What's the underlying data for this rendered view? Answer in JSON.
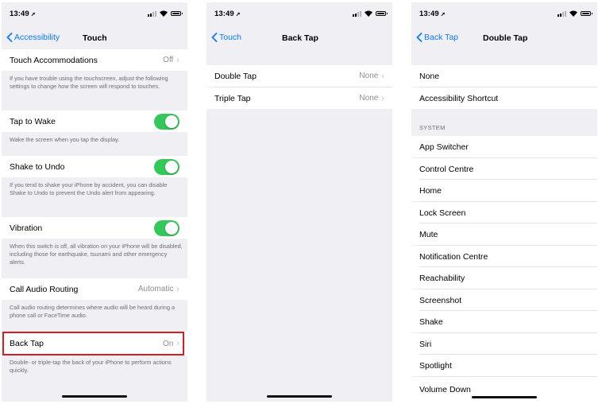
{
  "status": {
    "time": "13:49",
    "loc_icon": "location-arrow-icon"
  },
  "screen1": {
    "back_label": "Accessibility",
    "title": "Touch",
    "rows": {
      "touch_accommodations": {
        "label": "Touch Accommodations",
        "value": "Off"
      },
      "touch_accommodations_footer": "If you have trouble using the touchscreen, adjust the following settings to change how the screen will respond to touches.",
      "tap_to_wake": {
        "label": "Tap to Wake",
        "on": true
      },
      "tap_to_wake_footer": "Wake the screen when you tap the display.",
      "shake_to_undo": {
        "label": "Shake to Undo",
        "on": true
      },
      "shake_to_undo_footer": "If you tend to shake your iPhone by accident, you can disable Shake to Undo to prevent the Undo alert from appearing.",
      "vibration": {
        "label": "Vibration",
        "on": true
      },
      "vibration_footer": "When this switch is off, all vibration on your iPhone will be disabled, including those for earthquake, tsunami and other emergency alerts.",
      "call_audio_routing": {
        "label": "Call Audio Routing",
        "value": "Automatic"
      },
      "call_audio_routing_footer": "Call audio routing determines where audio will be heard during a phone call or FaceTime audio.",
      "back_tap": {
        "label": "Back Tap",
        "value": "On"
      },
      "back_tap_footer": "Double- or triple-tap the back of your iPhone to perform actions quickly."
    }
  },
  "screen2": {
    "back_label": "Touch",
    "title": "Back Tap",
    "rows": [
      {
        "label": "Double Tap",
        "value": "None"
      },
      {
        "label": "Triple Tap",
        "value": "None"
      }
    ]
  },
  "screen3": {
    "back_label": "Back Tap",
    "title": "Double Tap",
    "top_rows": [
      "None",
      "Accessibility Shortcut"
    ],
    "section_header": "SYSTEM",
    "system_rows": [
      "App Switcher",
      "Control Centre",
      "Home",
      "Lock Screen",
      "Mute",
      "Notification Centre",
      "Reachability",
      "Screenshot",
      "Shake",
      "Siri",
      "Spotlight",
      "Volume Down"
    ]
  },
  "colors": {
    "accent": "#0a7aff",
    "toggle_on": "#34c759",
    "highlight": "#d71d24",
    "background": "#efeff4"
  }
}
